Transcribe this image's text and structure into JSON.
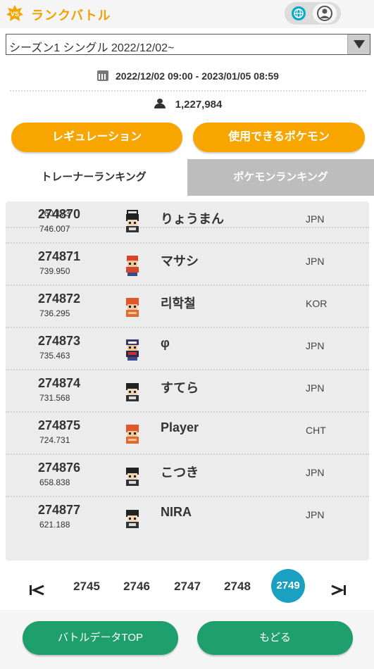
{
  "header": {
    "title": "ランクバトル",
    "badge_icon": "vs-badge-icon",
    "accent": "#f0a000"
  },
  "season_select": {
    "value": "シーズン1 シングル 2022/12/02~"
  },
  "info": {
    "period": "2022/12/02 09:00 - 2023/01/05 08:59",
    "players": "1,227,984"
  },
  "buttons": {
    "regulation": "レギュレーション",
    "usable_pokemon": "使用できるポケモン"
  },
  "tabs": {
    "trainer": "トレーナーランキング",
    "pokemon": "ポケモンランキング"
  },
  "ranking": {
    "partial_top_score": "760.173",
    "rows": [
      {
        "rank": "274870",
        "score": "746.007",
        "name": "りょうまん",
        "country": "JPN",
        "sprite": "black-hair-trainer"
      },
      {
        "rank": "274871",
        "score": "739.950",
        "name": "マサシ",
        "country": "JPN",
        "sprite": "red-cap-trainer"
      },
      {
        "rank": "274872",
        "score": "736.295",
        "name": "리학철",
        "country": "KOR",
        "sprite": "orange-hair-trainer"
      },
      {
        "rank": "274873",
        "score": "735.463",
        "name": "φ",
        "country": "JPN",
        "sprite": "cap-trainer"
      },
      {
        "rank": "274874",
        "score": "731.568",
        "name": "すてら",
        "country": "JPN",
        "sprite": "black-hair-trainer"
      },
      {
        "rank": "274875",
        "score": "724.731",
        "name": "Player",
        "country": "CHT",
        "sprite": "orange-hair-trainer"
      },
      {
        "rank": "274876",
        "score": "658.838",
        "name": "こつき",
        "country": "JPN",
        "sprite": "black-hair-trainer"
      },
      {
        "rank": "274877",
        "score": "621.188",
        "name": "NIRA",
        "country": "JPN",
        "sprite": "black-hair-trainer"
      }
    ]
  },
  "pagination": {
    "first": "|<",
    "pages": [
      "2745",
      "2746",
      "2747",
      "2748",
      "2749"
    ],
    "current": "2749",
    "last": ">|"
  },
  "footer": {
    "battle_data_top": "バトルデータTOP",
    "back": "もどる"
  },
  "colors": {
    "orange": "#f8a500",
    "green": "#1e9f6d",
    "teal": "#1aa0c0"
  }
}
